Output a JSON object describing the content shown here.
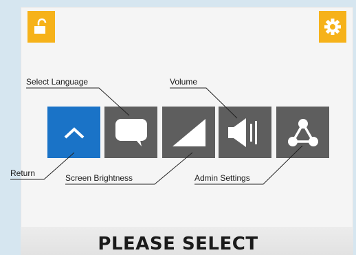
{
  "labels": {
    "select_language": "Select Language",
    "volume": "Volume",
    "return": "Return",
    "screen_brightness": "Screen Brightness",
    "admin_settings": "Admin Settings"
  },
  "prompt": "PLEASE SELECT",
  "icons": {
    "top_left": "unlock-icon",
    "top_right": "gear-icon",
    "tiles": [
      "chevron-up-icon",
      "speech-bubble-icon",
      "brightness-ramp-icon",
      "speaker-icon",
      "share-network-icon"
    ]
  },
  "colors": {
    "accent": "#f6b21a",
    "selected_tile": "#1a73c7",
    "tile": "#5e5e5e"
  }
}
